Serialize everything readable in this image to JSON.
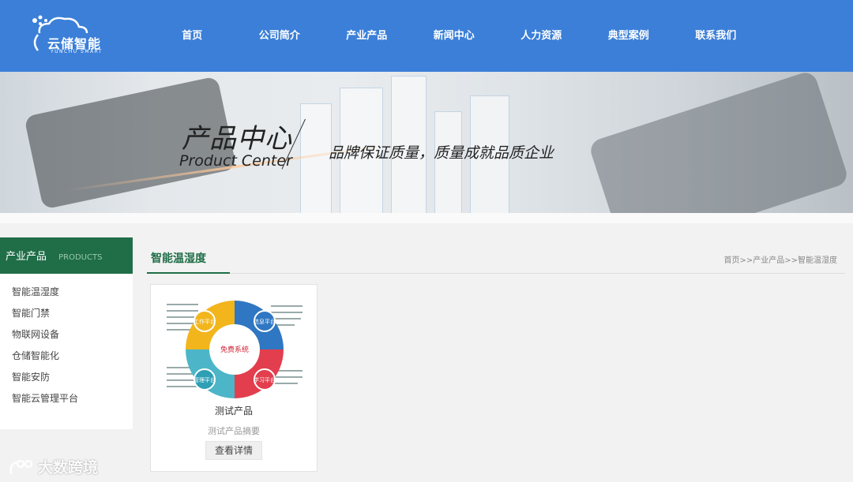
{
  "header": {
    "logo_text": "云储智能",
    "logo_sub": "YUNCHU SMART",
    "nav": [
      "首页",
      "公司简介",
      "产业产品",
      "新闻中心",
      "人力资源",
      "典型案例",
      "联系我们"
    ]
  },
  "banner": {
    "title_cn": "产品中心",
    "title_en": "Product Center",
    "slogan": "品牌保证质量，质量成就品质企业"
  },
  "sidebar": {
    "title_cn": "产业产品",
    "title_en": "PRODUCTS",
    "items": [
      "智能温湿度",
      "智能门禁",
      "物联网设备",
      "仓储智能化",
      "智能安防",
      "智能云管理平台"
    ]
  },
  "content": {
    "title": "智能温湿度",
    "breadcrumb": "首页>>产业产品>>智能温湿度"
  },
  "product": {
    "name": "测试产品",
    "summary": "测试产品摘要",
    "detail_label": "查看详情",
    "thumb": {
      "center_label": "免费系统",
      "segments": [
        "工作平台",
        "信息平台",
        "管理平台",
        "学习平台"
      ]
    }
  },
  "watermark": "大数跨境",
  "colors": {
    "header_blue": "#3b7fd8",
    "sidebar_green": "#1f6e47"
  }
}
